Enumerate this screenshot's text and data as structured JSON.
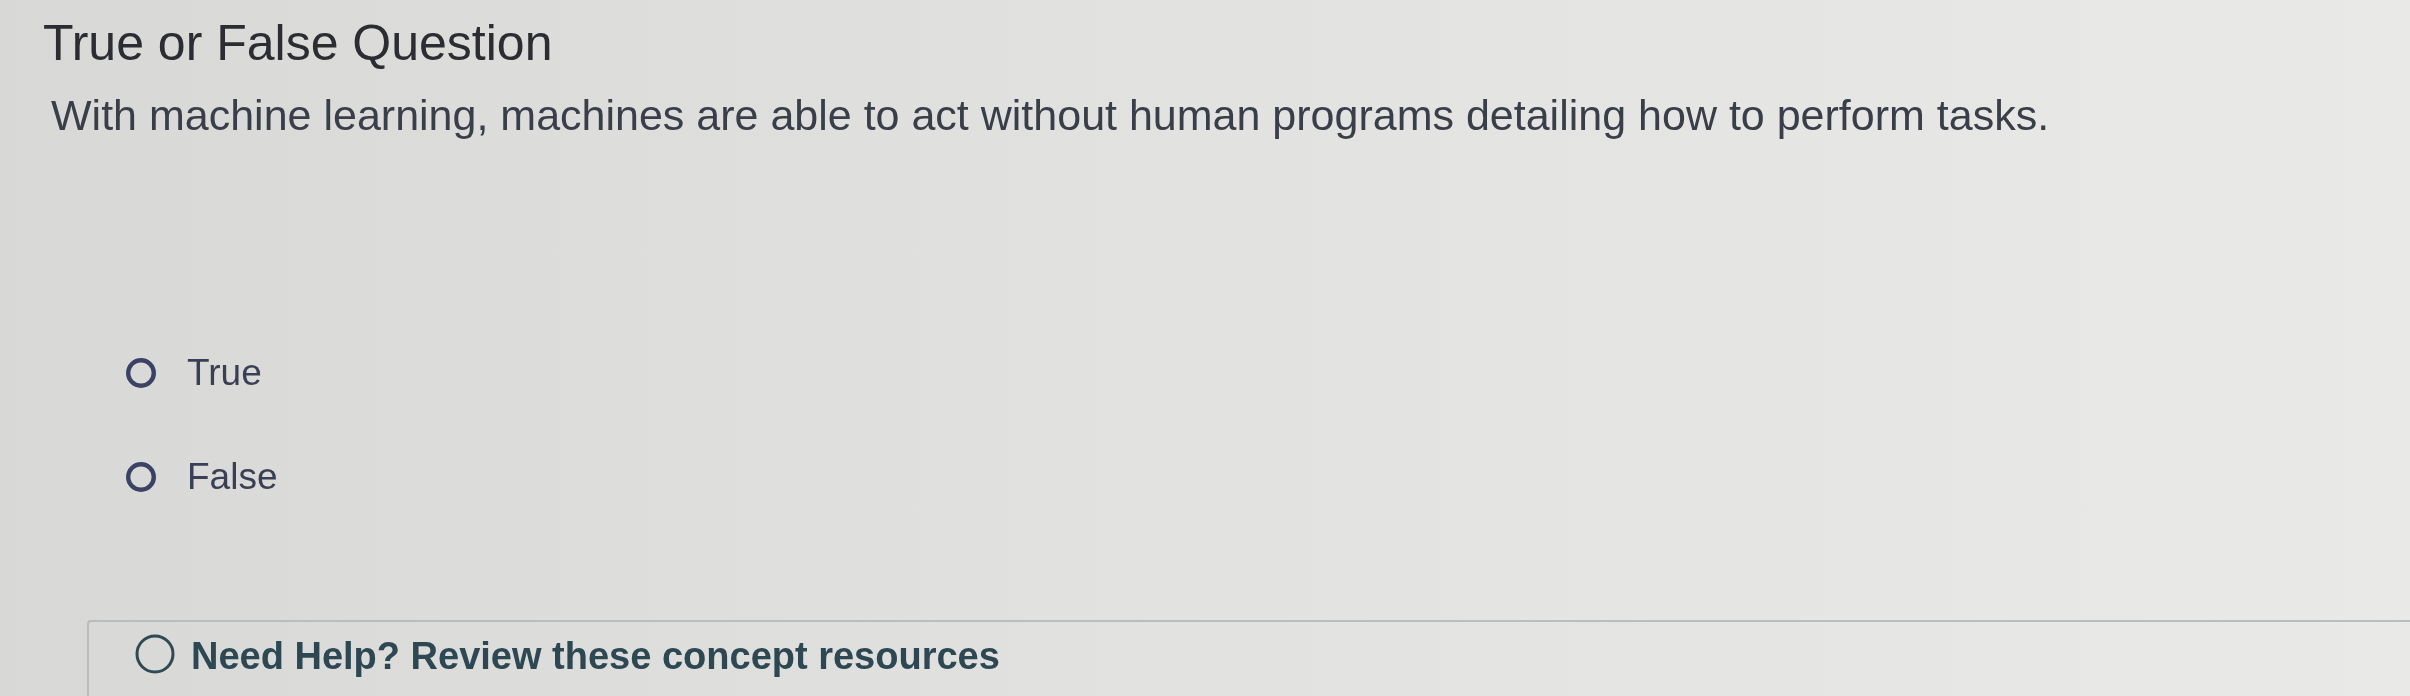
{
  "title": "True or False Question",
  "question": "With machine learning, machines are able to act without human programs detailing how to perform tasks.",
  "options": [
    {
      "label": "True",
      "selected": false
    },
    {
      "label": "False",
      "selected": false
    }
  ],
  "help": {
    "text": "Need Help? Review these concept resources"
  }
}
